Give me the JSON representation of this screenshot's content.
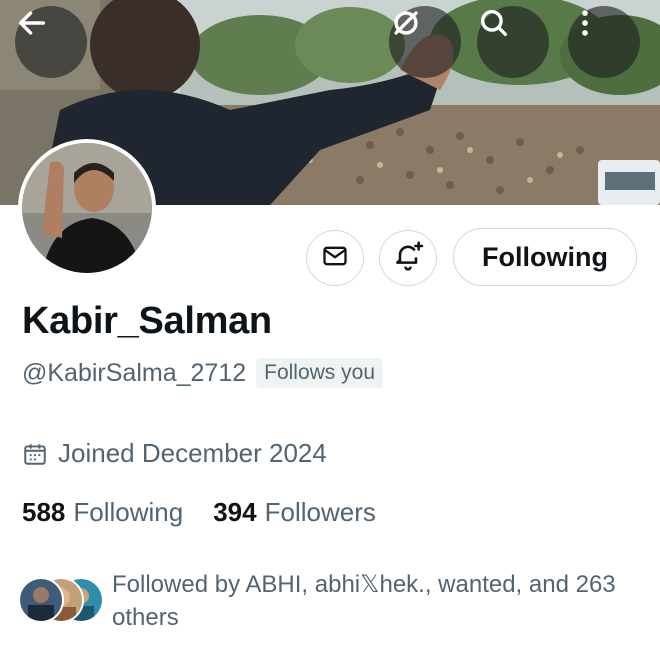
{
  "header": {
    "back_icon": "arrow-left-icon",
    "grok_icon": "grok-icon",
    "search_icon": "search-icon",
    "more_icon": "more-vertical-icon"
  },
  "profile": {
    "name": "Kabir_Salman",
    "handle": "@KabirSalma_2712",
    "follows_you": "Follows you",
    "joined": "Joined December 2024",
    "following_button": "Following",
    "following_count": "588",
    "following_label": "Following",
    "followers_count": "394",
    "followers_label": "Followers",
    "followed_by": "Followed by ABHI, abhi𝕏hek., wanted, and 263 others"
  },
  "colors": {
    "text_primary": "#0f1419",
    "text_secondary": "#536471",
    "border": "#cfd9de",
    "badge_bg": "#eff3f4"
  }
}
